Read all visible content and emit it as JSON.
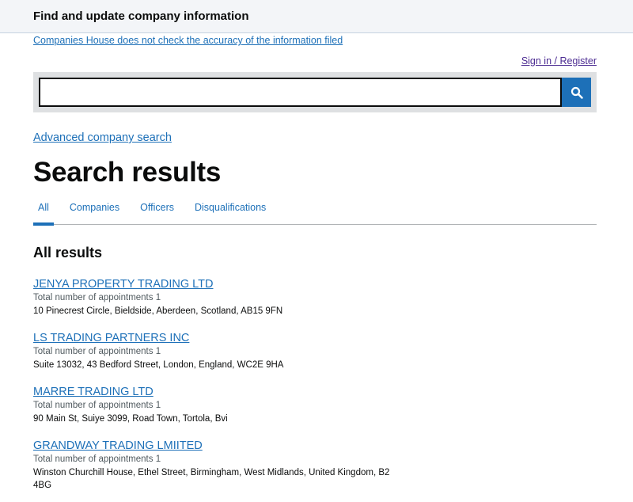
{
  "header": {
    "title": "Find and update company information"
  },
  "disclaimer": {
    "text": "Companies House does not check the accuracy of the information filed"
  },
  "account": {
    "signin_label": "Sign in / Register"
  },
  "search": {
    "value": "",
    "placeholder": "",
    "button_icon": "search-icon"
  },
  "advanced_search": {
    "label": "Advanced company search"
  },
  "page": {
    "title": "Search results"
  },
  "tabs": [
    {
      "label": "All",
      "active": true
    },
    {
      "label": "Companies",
      "active": false
    },
    {
      "label": "Officers",
      "active": false
    },
    {
      "label": "Disqualifications",
      "active": false
    }
  ],
  "results_section": {
    "title": "All results"
  },
  "results": [
    {
      "name": "JENYA PROPERTY TRADING LTD",
      "meta": "Total number of appointments 1",
      "address": "10 Pinecrest Circle, Bieldside, Aberdeen, Scotland, AB15 9FN"
    },
    {
      "name": "LS TRADING PARTNERS INC",
      "meta": "Total number of appointments 1",
      "address": "Suite 13032, 43 Bedford Street, London, England, WC2E 9HA"
    },
    {
      "name": "MARRE TRADING LTD",
      "meta": "Total number of appointments 1",
      "address": "90 Main St, Suiye 3099, Road Town, Tortola, Bvi"
    },
    {
      "name": "GRANDWAY TRADING LMIITED",
      "meta": "Total number of appointments 1",
      "address": "Winston Churchill House, Ethel Street, Birmingham, West Midlands, United Kingdom, B2 4BG"
    }
  ],
  "colors": {
    "link": "#1d70b8",
    "visited_link": "#4c2c92",
    "header_bg": "#f3f5f8",
    "search_bg": "#dee0e2",
    "button_bg": "#1d70b8"
  }
}
